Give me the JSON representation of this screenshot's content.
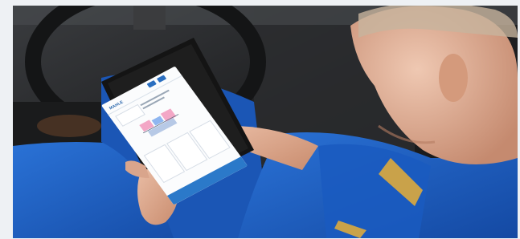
{
  "image": {
    "subject": "mechanic-using-tablet",
    "tablet": {
      "brand_text": "MAHLE"
    },
    "colors": {
      "uniform": "#1f63c4",
      "skin": "#d9a58c",
      "interior": "#262626",
      "tablet_frame": "#1a1a1a",
      "screen_accent": "#2b79c9",
      "background": "#eef1f4"
    }
  }
}
